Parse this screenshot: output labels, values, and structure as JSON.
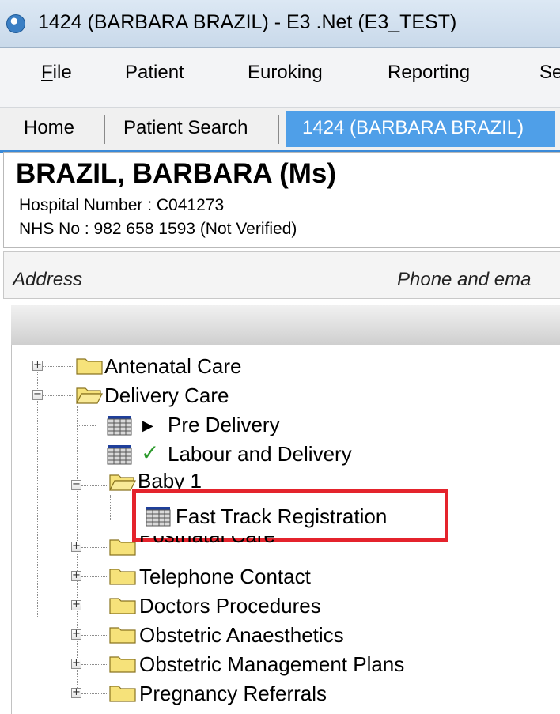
{
  "window": {
    "title": "1424 (BARBARA BRAZIL) - E3 .Net (E3_TEST)"
  },
  "menu": {
    "file_prefix": "F",
    "file_rest": "ile",
    "items": [
      "Patient",
      "Euroking",
      "Reporting",
      "Se"
    ]
  },
  "tabs": [
    {
      "label": "Home"
    },
    {
      "label": "Patient Search"
    },
    {
      "label": "1424 (BARBARA BRAZIL)",
      "active": true
    }
  ],
  "patient": {
    "name": "BRAZIL, BARBARA (Ms)",
    "hospital_number": "Hospital Number : C041273",
    "nhs_number": "NHS No : 982 658 1593 (Not Verified)"
  },
  "info_columns": [
    "Address",
    "Phone and ema"
  ],
  "tree": {
    "antenatal_care": "Antenatal Care",
    "delivery_care": "Delivery Care",
    "pre_delivery": "Pre Delivery",
    "labour_and_delivery": "Labour and Delivery",
    "baby_1": "Baby 1",
    "fast_track_registration": "Fast Track Registration",
    "postnatal_care": "Postnatal Care",
    "telephone_contact": "Telephone Contact",
    "doctors_procedures": "Doctors Procedures",
    "obstetric_anaesthetics": "Obstetric Anaesthetics",
    "obstetric_management_plans": "Obstetric Management Plans",
    "pregnancy_referrals": "Pregnancy Referrals"
  },
  "colors": {
    "active_tab": "#4f9fe8",
    "highlight_border": "#e4232c",
    "check": "#2c9a2c",
    "folder": "#f6e27a"
  },
  "icons": {
    "expand": "plus-box",
    "collapse": "minus-box",
    "folder": "folder-icon",
    "form": "form-grid-icon",
    "status_pending": "play-arrow",
    "status_complete": "checkmark"
  }
}
